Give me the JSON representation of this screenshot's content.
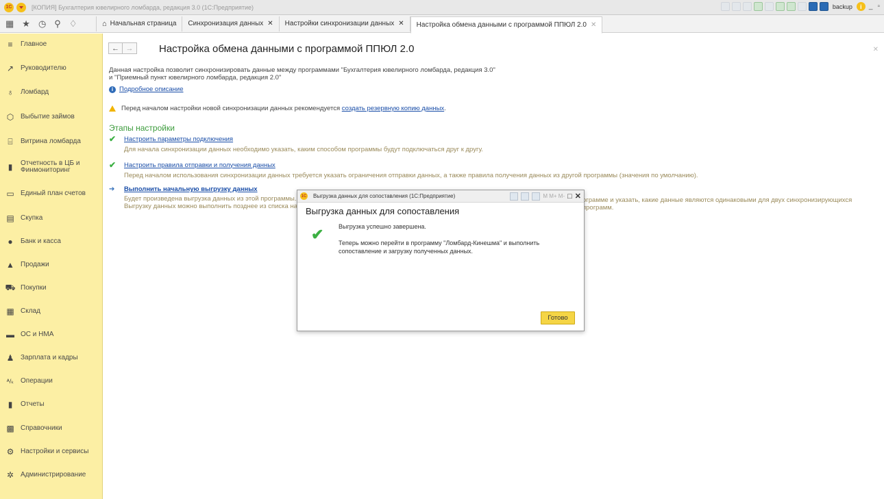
{
  "window": {
    "title": "[КОПИЯ] Бухгалтерия ювелирного ломбарда, редакция 3.0  (1С:Предприятие)",
    "logo_text": "1С",
    "user": "backup"
  },
  "tabs": [
    {
      "label": "Начальная страница"
    },
    {
      "label": "Синхронизация данных"
    },
    {
      "label": "Настройки синхронизации данных"
    },
    {
      "label": "Настройка обмена данными с программой ППЮЛ 2.0"
    }
  ],
  "sidebar": {
    "items": [
      {
        "label": "Главное",
        "icon": "menu-icon"
      },
      {
        "label": "Руководителю",
        "icon": "trend-icon"
      },
      {
        "label": "Ломбард",
        "icon": "ring-icon"
      },
      {
        "label": "Выбытие займов",
        "icon": "box-icon"
      },
      {
        "label": "Витрина ломбарда",
        "icon": "shop-icon"
      },
      {
        "label": "Отчетность в ЦБ и Финмониторинг",
        "icon": "bar-chart-icon"
      },
      {
        "label": "Единый план счетов",
        "icon": "book-icon"
      },
      {
        "label": "Скупка",
        "icon": "cash-register-icon"
      },
      {
        "label": "Банк и касса",
        "icon": "bank-icon"
      },
      {
        "label": "Продажи",
        "icon": "bag-icon"
      },
      {
        "label": "Покупки",
        "icon": "cart-icon"
      },
      {
        "label": "Склад",
        "icon": "warehouse-icon"
      },
      {
        "label": "ОС и НМА",
        "icon": "truck-icon"
      },
      {
        "label": "Зарплата и кадры",
        "icon": "person-icon"
      },
      {
        "label": "Операции",
        "icon": "operations-icon"
      },
      {
        "label": "Отчеты",
        "icon": "report-icon"
      },
      {
        "label": "Справочники",
        "icon": "folder-icon"
      },
      {
        "label": "Настройки и сервисы",
        "icon": "gear-icon"
      },
      {
        "label": "Администрирование",
        "icon": "gear-small-icon"
      }
    ]
  },
  "main": {
    "title": "Настройка обмена данными с программой ППЮЛ 2.0",
    "description_line1": "Данная настройка позволит синхронизировать данные между программами \"Бухгалтерия ювелирного ломбарда, редакция 3.0\"",
    "description_line2": "и \"Приемный пункт ювелирного ломбарда, редакция 2.0\"",
    "details_link": "Подробное описание",
    "warning_text": "Перед началом настройки новой синхронизации данных рекомендуется",
    "warning_link": "создать резервную копию данных",
    "warning_end": ".",
    "stages_heading": "Этапы настройки",
    "steps": [
      {
        "link": "Настроить параметры подключения",
        "text": "Для начала синхронизации данных необходимо указать, каким способом программы будут подключаться друг к другу."
      },
      {
        "link": "Настроить правила отправки и получения данных",
        "text": "Перед началом использования синхронизации данных требуется указать ограничения отправки данных, а также правила получения данных из другой программы (значения по умолчанию)."
      },
      {
        "link": "Выполнить начальную выгрузку данных",
        "text": "Будет произведена выгрузка данных из этой программы. Сра",
        "text_right": "ограмме и указать, какие данные являются одинаковыми для двух синхронизирующихся программ.",
        "text2": "Выгрузку данных можно выполнить позднее из списка настро"
      }
    ]
  },
  "dialog": {
    "title": "Выгрузка данных для сопоставления  (1С:Предприятие)",
    "heading": "Выгрузка данных для сопоставления",
    "message1": "Выгрузка успешно завершена.",
    "message2": "Теперь можно перейти в программу \"Ломбард-Кинешма\" и выполнить сопоставление и загрузку полученных данных.",
    "done_button": "Готово"
  }
}
